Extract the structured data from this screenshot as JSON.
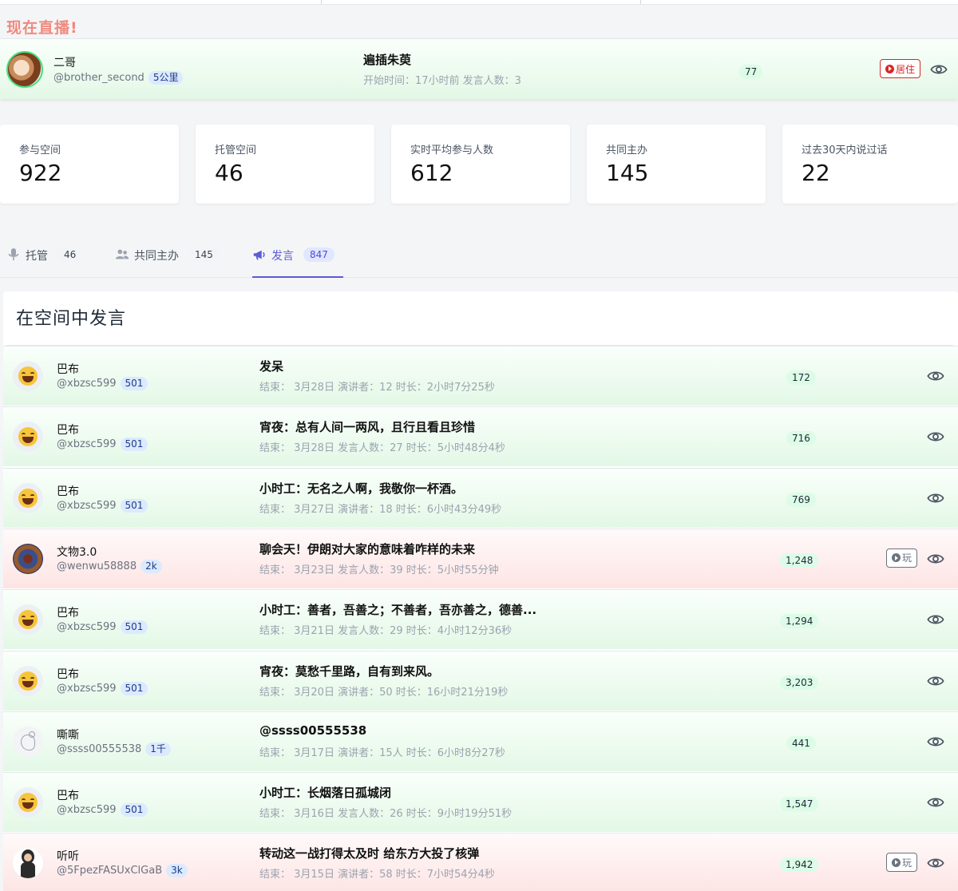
{
  "live_section_title": "现在直播!",
  "live": {
    "host_name": "二哥",
    "host_handle": "@brother_second",
    "host_badge": "5公里",
    "topic": "遍插朱萸",
    "meta": "开始时间：17小时前 发言人数：3",
    "count": "77",
    "join_label": "居住"
  },
  "stats": [
    {
      "label": "参与空间",
      "value": "922"
    },
    {
      "label": "托管空间",
      "value": "46"
    },
    {
      "label": "实时平均参与人数",
      "value": "612"
    },
    {
      "label": "共同主办",
      "value": "145"
    },
    {
      "label": "过去30天内说过话",
      "value": "22"
    }
  ],
  "tabs": [
    {
      "label": "托管",
      "count": "46",
      "icon": "microphone-icon"
    },
    {
      "label": "共同主办",
      "count": "145",
      "icon": "users-icon"
    },
    {
      "label": "发言",
      "count": "847",
      "icon": "megaphone-icon",
      "active": true
    }
  ],
  "panel_title": "在空间中发言",
  "rows": [
    {
      "name": "巴布",
      "handle": "@xbzsc599",
      "badge": "501",
      "topic": "发呆",
      "meta": "结束： 3月28日 演讲者：12 时长：2小时7分25秒",
      "count": "172",
      "tone": "green",
      "avatar": "laughing-emoji",
      "play": false
    },
    {
      "name": "巴布",
      "handle": "@xbzsc599",
      "badge": "501",
      "topic": "宵夜：总有人间一两风，且行且看且珍惜",
      "meta": "结束： 3月28日 发言人数：27 时长：5小时48分4秒",
      "count": "716",
      "tone": "green",
      "avatar": "laughing-emoji",
      "play": false
    },
    {
      "name": "巴布",
      "handle": "@xbzsc599",
      "badge": "501",
      "topic": "小时工：无名之人啊，我敬你一杯酒。",
      "meta": "结束： 3月27日 演讲者：18 时长：6小时43分49秒",
      "count": "769",
      "tone": "green",
      "avatar": "laughing-emoji",
      "play": false
    },
    {
      "name": "文物3.0",
      "handle": "@wenwu58888",
      "badge": "2k",
      "topic": "聊会天！伊朗对大家的意味着咋样的未来",
      "meta": "结束： 3月23日 发言人数：39 时长：5小时55分钟",
      "count": "1,248",
      "tone": "red",
      "avatar": "artifact-photo",
      "play": true,
      "play_label": "玩"
    },
    {
      "name": "巴布",
      "handle": "@xbzsc599",
      "badge": "501",
      "topic": "小时工：善者，吾善之；不善者，吾亦善之，德善...",
      "meta": "结束： 3月21日 发言人数：29 时长：4小时12分36秒",
      "count": "1,294",
      "tone": "green",
      "avatar": "laughing-emoji",
      "play": false
    },
    {
      "name": "巴布",
      "handle": "@xbzsc599",
      "badge": "501",
      "topic": "宵夜：莫愁千里路，自有到来风。",
      "meta": "结束： 3月20日 演讲者：50 时长：16小时21分19秒",
      "count": "3,203",
      "tone": "green",
      "avatar": "laughing-emoji",
      "play": false
    },
    {
      "name": "嘶嘶",
      "handle": "@ssss00555538",
      "badge": "1千",
      "topic": "@ssss00555538",
      "meta": "结束： 3月17日 演讲者：15人 时长：6小时8分27秒",
      "count": "441",
      "tone": "green",
      "avatar": "bird-sketch",
      "play": false
    },
    {
      "name": "巴布",
      "handle": "@xbzsc599",
      "badge": "501",
      "topic": "小时工：长烟落日孤城闭",
      "meta": "结束： 3月16日 发言人数：26 时长：9小时19分51秒",
      "count": "1,547",
      "tone": "green",
      "avatar": "laughing-emoji",
      "play": false
    },
    {
      "name": "听听",
      "handle": "@5FpezFASUxClGaB",
      "badge": "3k",
      "topic": "转动这一战打得太及时 给东方大投了核弹",
      "meta": "结束： 3月15日 演讲者：58 时长：7小时54分4秒",
      "count": "1,942",
      "tone": "red",
      "avatar": "person-photo",
      "play": true,
      "play_label": "玩"
    }
  ]
}
